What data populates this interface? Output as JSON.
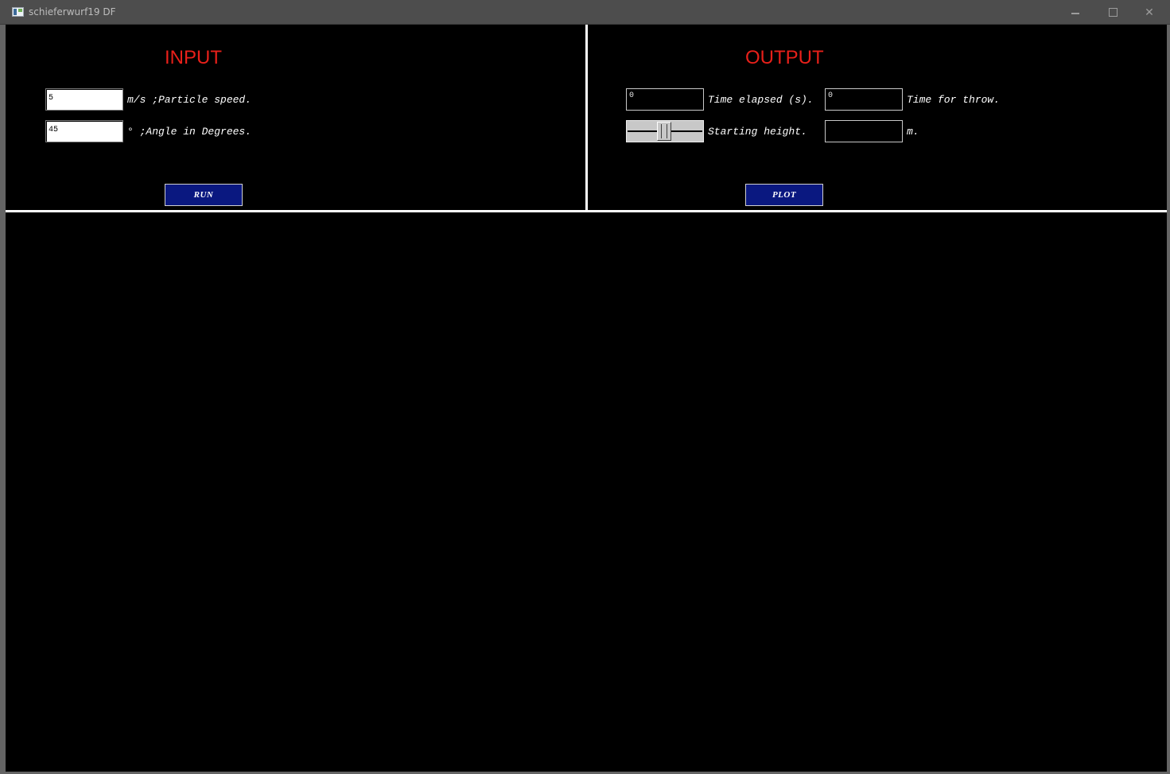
{
  "window": {
    "title": "schieferwurf19 DF",
    "min_symbol": "",
    "max_symbol": "",
    "close_symbol": "✕"
  },
  "input": {
    "heading": "INPUT",
    "speed_value": "5",
    "speed_label": "m/s ;Particle speed.",
    "angle_value": "45",
    "angle_label": "° ;Angle in Degrees.",
    "run_label": "RUN"
  },
  "output": {
    "heading": "OUTPUT",
    "time_elapsed_value": "0",
    "time_elapsed_label": "Time elapsed (s).",
    "time_throw_value": "0",
    "time_throw_label": "Time for throw.",
    "starting_height_label": "Starting height.",
    "starting_height_slider_fraction": 0.5,
    "height_value": "",
    "height_unit_label": "m.",
    "plot_label": "PLOT"
  }
}
